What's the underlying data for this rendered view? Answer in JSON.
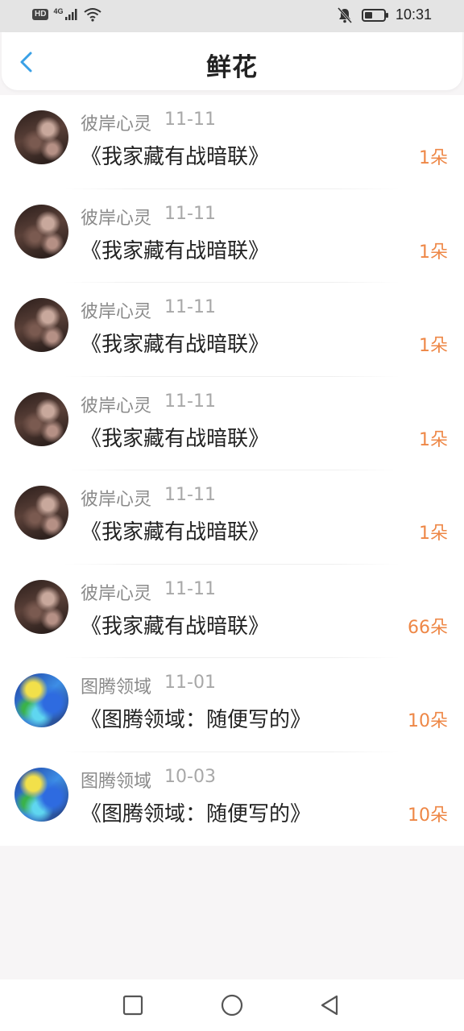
{
  "status_bar": {
    "hd": "HD",
    "network": "4G",
    "time": "10:31",
    "battery_level": 0.4,
    "icons": [
      "signal-icon",
      "wifi-icon",
      "mute-icon",
      "battery-icon"
    ]
  },
  "header": {
    "title": "鲜花",
    "back_icon": "chevron-left-icon",
    "accent_color": "#3aa0e6"
  },
  "items": [
    {
      "author": "彼岸心灵",
      "date": "11-11",
      "title": "《我家藏有战暗联》",
      "count": "1朵",
      "avatar": "dark"
    },
    {
      "author": "彼岸心灵",
      "date": "11-11",
      "title": "《我家藏有战暗联》",
      "count": "1朵",
      "avatar": "dark"
    },
    {
      "author": "彼岸心灵",
      "date": "11-11",
      "title": "《我家藏有战暗联》",
      "count": "1朵",
      "avatar": "dark"
    },
    {
      "author": "彼岸心灵",
      "date": "11-11",
      "title": "《我家藏有战暗联》",
      "count": "1朵",
      "avatar": "dark"
    },
    {
      "author": "彼岸心灵",
      "date": "11-11",
      "title": "《我家藏有战暗联》",
      "count": "1朵",
      "avatar": "dark"
    },
    {
      "author": "彼岸心灵",
      "date": "11-11",
      "title": "《我家藏有战暗联》",
      "count": "66朵",
      "avatar": "dark"
    },
    {
      "author": "图腾领域",
      "date": "11-01",
      "title": "《图腾领域：随便写的》",
      "count": "10朵",
      "avatar": "blue"
    },
    {
      "author": "图腾领域",
      "date": "10-03",
      "title": "《图腾领域：随便写的》",
      "count": "10朵",
      "avatar": "blue"
    }
  ],
  "colors": {
    "count": "#ee8746",
    "meta": "#8a8a8a"
  },
  "nav_bar": {
    "icons": [
      "recent-apps-icon",
      "home-icon",
      "back-triangle-icon"
    ]
  }
}
